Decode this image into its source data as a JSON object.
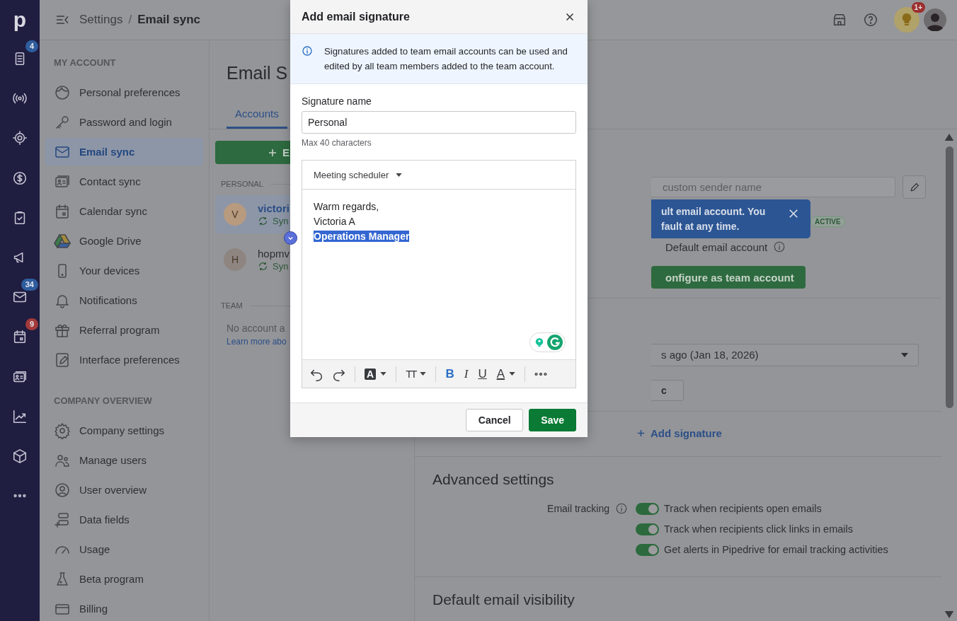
{
  "rail": {
    "logo": "p",
    "badges": {
      "document": {
        "text": "4",
        "urgent": false
      },
      "mail": {
        "text": "34",
        "urgent": false
      },
      "calendar": {
        "text": "9",
        "urgent": true
      }
    }
  },
  "topbar": {
    "breadcrumb": [
      {
        "label": "Settings",
        "current": false
      },
      {
        "label": "Email sync",
        "current": true
      }
    ],
    "separator": "/",
    "notification_badge": "1+"
  },
  "settings_nav": {
    "sections": [
      {
        "title": "MY ACCOUNT",
        "items": [
          {
            "label": "Personal preferences",
            "selected": false
          },
          {
            "label": "Password and login",
            "selected": false
          },
          {
            "label": "Email sync",
            "selected": true
          },
          {
            "label": "Contact sync",
            "selected": false
          },
          {
            "label": "Calendar sync",
            "selected": false
          },
          {
            "label": "Google Drive",
            "selected": false
          },
          {
            "label": "Your devices",
            "selected": false
          },
          {
            "label": "Notifications",
            "selected": false
          },
          {
            "label": "Referral program",
            "selected": false
          },
          {
            "label": "Interface preferences",
            "selected": false
          }
        ]
      },
      {
        "title": "COMPANY OVERVIEW",
        "items": [
          {
            "label": "Company settings",
            "selected": false
          },
          {
            "label": "Manage users",
            "selected": false
          },
          {
            "label": "User overview",
            "selected": false
          },
          {
            "label": "Data fields",
            "selected": false
          },
          {
            "label": "Usage",
            "selected": false
          },
          {
            "label": "Beta program",
            "selected": false
          },
          {
            "label": "Billing",
            "selected": false
          }
        ]
      }
    ]
  },
  "page": {
    "title": "Email S",
    "tabs": [
      {
        "label": "Accounts",
        "selected": true
      }
    ],
    "add_button": "E"
  },
  "accounts": {
    "groups": [
      {
        "title": "PERSONAL",
        "items": [
          {
            "initial": "V",
            "name": "victori",
            "status": "Syn",
            "selected": true,
            "color": "#b89a7f"
          },
          {
            "initial": "H",
            "name": "hopmv",
            "status": "Syn",
            "selected": false,
            "color": "#8f8580"
          }
        ]
      },
      {
        "title": "TEAM",
        "empty_text": "No account a",
        "link": "Learn more abo"
      }
    ]
  },
  "account_detail": {
    "sender_field": {
      "placeholder": "custom sender name"
    },
    "tooltip": "ult email account. You fault at any time.",
    "status_badge": "ACTIVE",
    "default_label": "Default email account",
    "team_button": "onfigure as team account",
    "sync_dropdown": {
      "value": "s ago (Jan 18, 2026)"
    },
    "sync_button": "c",
    "add_signature": "Add signature",
    "advanced": {
      "title": "Advanced settings",
      "label": "Email tracking",
      "toggles": [
        {
          "label": "Track when recipients open emails",
          "on": true
        },
        {
          "label": "Track when recipients click links in emails",
          "on": true
        },
        {
          "label": "Get alerts in Pipedrive for email tracking activities",
          "on": true
        }
      ]
    },
    "visibility_title": "Default email visibility"
  },
  "dialog": {
    "title": "Add email signature",
    "info": "Signatures added to team email accounts can be used and edited by all team members added to the team account.",
    "name_label": "Signature name",
    "name_value": "Personal",
    "name_help": "Max 40 characters",
    "template_dropdown": "Meeting scheduler",
    "lines": [
      {
        "text": "Warm regards,",
        "selected": false,
        "bold": false
      },
      {
        "text": "Victoria A",
        "selected": false,
        "bold": false
      },
      {
        "text": "Operations Manager",
        "selected": true,
        "bold": true
      }
    ],
    "toolbar": [
      {
        "kind": "undo"
      },
      {
        "kind": "redo"
      },
      {
        "kind": "separator"
      },
      {
        "kind": "highlight",
        "label": "A",
        "active": false
      },
      {
        "kind": "separator"
      },
      {
        "kind": "size",
        "label": "TT",
        "active": false
      },
      {
        "kind": "separator"
      },
      {
        "kind": "bold",
        "label": "B",
        "active": true
      },
      {
        "kind": "italic",
        "label": "I",
        "active": false
      },
      {
        "kind": "underline",
        "label": "U",
        "active": false
      },
      {
        "kind": "color",
        "label": "A",
        "active": false
      },
      {
        "kind": "separator"
      },
      {
        "kind": "more"
      }
    ],
    "buttons": [
      {
        "label": "Cancel",
        "kind": "secondary"
      },
      {
        "label": "Save",
        "kind": "primary"
      }
    ]
  }
}
